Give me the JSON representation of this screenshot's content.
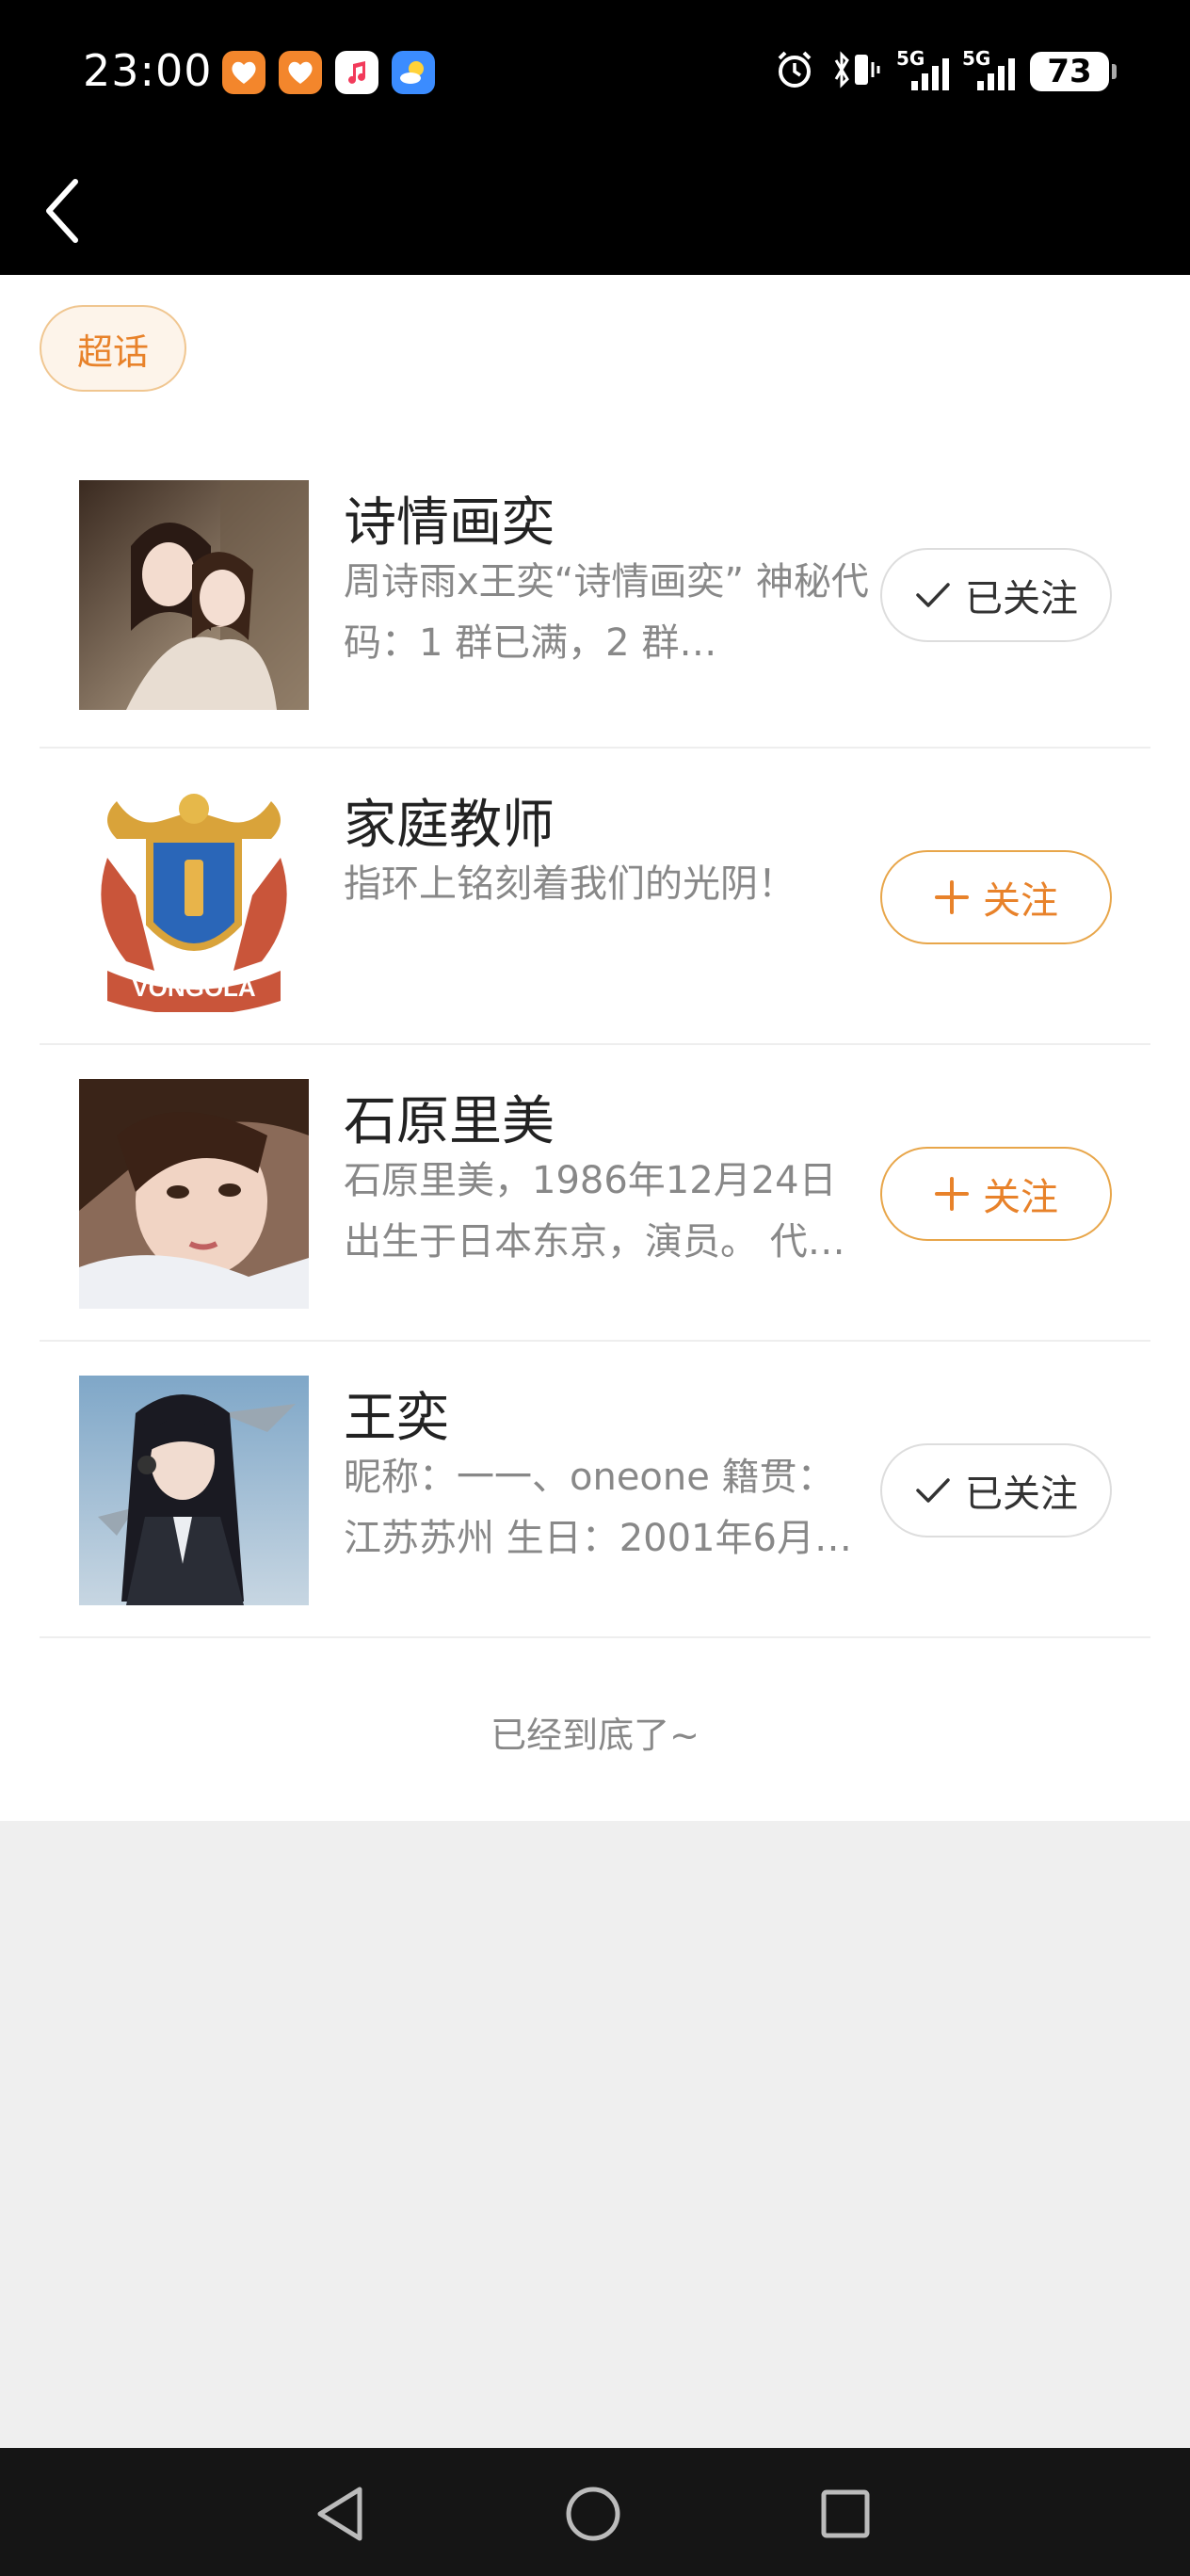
{
  "status_bar": {
    "time": "23:00",
    "app_icons": [
      "heart-app-icon",
      "heart-app-icon",
      "music-app-icon",
      "weather-app-icon"
    ],
    "signal_label_1": "5G",
    "signal_label_2": "5G",
    "battery": "73"
  },
  "header": {
    "back_icon": "chevron-left-icon"
  },
  "tag": {
    "label": "超话"
  },
  "items": [
    {
      "title": "诗情画奕",
      "desc": "周诗雨x王奕“诗情画奕” 神秘代码：1 群已满，2 群…",
      "follow_label": "已关注",
      "followed": true
    },
    {
      "title": "家庭教师",
      "desc": "指环上铭刻着我们的光阴！",
      "follow_label": "关注",
      "followed": false,
      "logo_text": "VONGOLA"
    },
    {
      "title": "石原里美",
      "desc": "石原里美，1986年12月24日出生于日本东京，演员。 代…",
      "follow_label": "关注",
      "followed": false
    },
    {
      "title": "王奕",
      "desc": "昵称：一一、oneone 籍贯：江苏苏州 生日：2001年6月6…",
      "follow_label": "已关注",
      "followed": true
    }
  ],
  "end_text": "已经到底了~",
  "colors": {
    "accent": "#e8822a",
    "chip_bg": "#fdf4ea",
    "page_bg": "#efefef"
  }
}
